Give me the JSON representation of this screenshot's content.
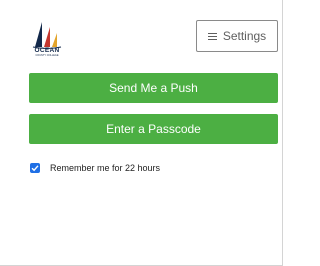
{
  "brand": {
    "name": "OCEAN",
    "subtitle": "COUNTY COLLEGE",
    "colors": {
      "navy": "#12284a",
      "sail_red": "#c6372f",
      "sail_gold": "#e3a42b"
    }
  },
  "header": {
    "settings_button": {
      "label": "Settings",
      "icon": "menu-icon"
    }
  },
  "actions": {
    "push_button_label": "Send Me a Push",
    "passcode_button_label": "Enter a Passcode",
    "button_color": "#4caf43"
  },
  "remember": {
    "label": "Remember me for 22 hours",
    "checked": true,
    "accent_color": "#1f6fe5"
  }
}
